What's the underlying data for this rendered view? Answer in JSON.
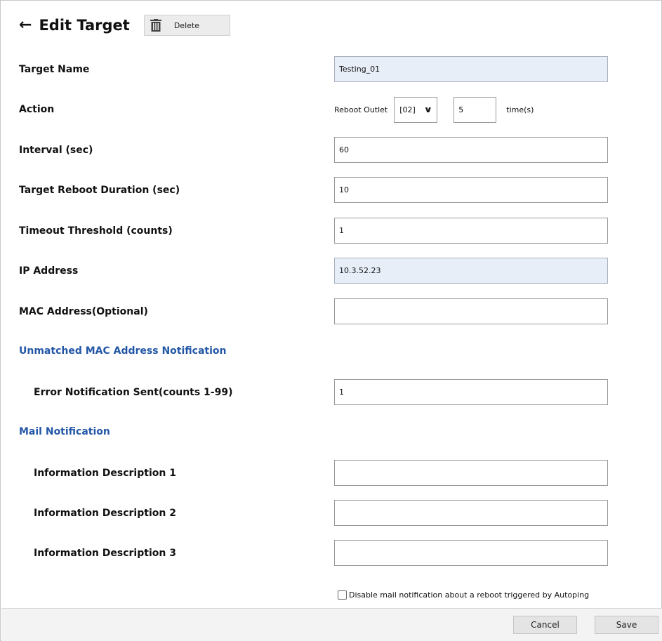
{
  "header": {
    "back_icon": "arrow-left-icon",
    "title": "Edit Target",
    "delete_icon": "trash-icon",
    "delete_label": "Delete"
  },
  "form": {
    "target_name": {
      "label": "Target Name",
      "value": "Testing_01"
    },
    "action": {
      "label": "Action",
      "prefix": "Reboot Outlet",
      "outlet_selected": "[02]",
      "times_value": "5",
      "times_unit": "time(s)"
    },
    "interval": {
      "label": "Interval (sec)",
      "value": "60"
    },
    "reboot_duration": {
      "label": "Target Reboot Duration (sec)",
      "value": "10"
    },
    "timeout_threshold": {
      "label": "Timeout Threshold (counts)",
      "value": "1"
    },
    "ip_address": {
      "label": "IP Address",
      "value": "10.3.52.23"
    },
    "mac_address": {
      "label": "MAC Address(Optional)",
      "value": ""
    }
  },
  "unmatched_section": {
    "title": "Unmatched MAC Address Notification",
    "error_notification": {
      "label": "Error Notification Sent(counts 1-99)",
      "value": "1"
    }
  },
  "mail_section": {
    "title": "Mail Notification",
    "desc1": {
      "label": "Information Description 1",
      "value": ""
    },
    "desc2": {
      "label": "Information Description 2",
      "value": ""
    },
    "desc3": {
      "label": "Information Description 3",
      "value": ""
    },
    "disable_checkbox_label": "Disable mail notification about a reboot triggered by Autoping"
  },
  "footer": {
    "cancel_label": "Cancel",
    "save_label": "Save"
  },
  "colors": {
    "section_title": "#2457a6",
    "readonly_field_bg": "#e8eef8"
  }
}
